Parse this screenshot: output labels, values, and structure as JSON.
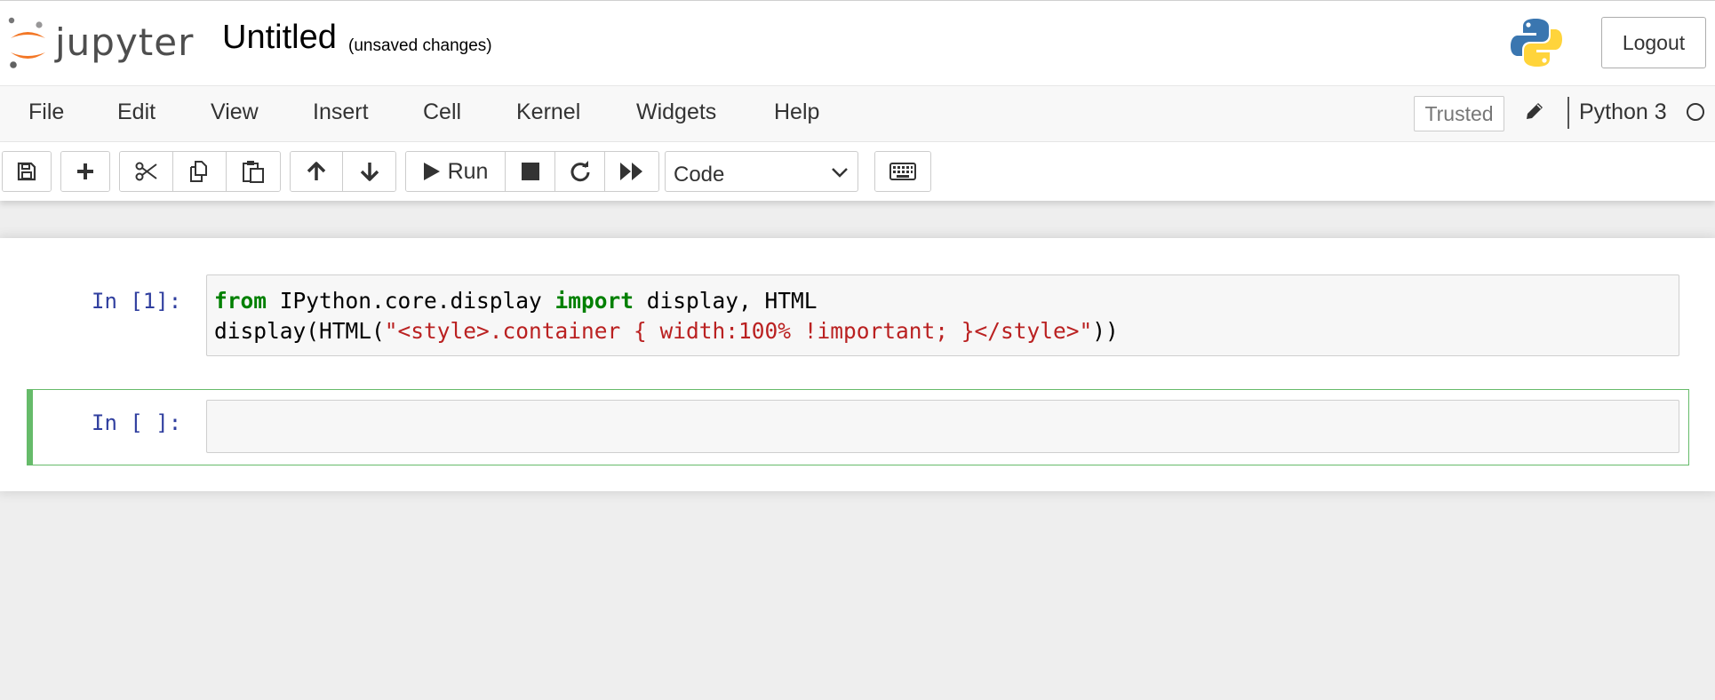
{
  "header": {
    "logo_text": "jupyter",
    "notebook_title": "Untitled",
    "save_status": "(unsaved changes)",
    "logout_label": "Logout"
  },
  "menubar": {
    "items": [
      "File",
      "Edit",
      "View",
      "Insert",
      "Cell",
      "Kernel",
      "Widgets",
      "Help"
    ],
    "trusted_label": "Trusted",
    "kernel_name": "Python 3"
  },
  "toolbar": {
    "buttons": [
      "save-icon",
      "plus-icon",
      "cut-icon",
      "copy-icon",
      "paste-icon",
      "arrow-up-icon",
      "arrow-down-icon",
      "play-icon",
      "stop-icon",
      "restart-icon",
      "fast-forward-icon",
      "keyboard-icon"
    ],
    "run_label": "Run",
    "cell_type": "Code"
  },
  "cells": [
    {
      "prompt": "In [1]:",
      "code": {
        "line1_kw1": "from",
        "line1_mid": " IPython.core.display ",
        "line1_kw2": "import",
        "line1_end": " display, HTML",
        "line2_start": "display(HTML(",
        "line2_str": "\"<style>.container { width:100% !important; }</style>\"",
        "line2_end": "))"
      }
    },
    {
      "prompt": "In [ ]:",
      "code": ""
    }
  ],
  "colors": {
    "prompt": "#303f9f",
    "keyword": "#008000",
    "string": "#ba2121",
    "selected_cell_border": "#66bb6a",
    "jupyter_orange": "#f37726"
  }
}
